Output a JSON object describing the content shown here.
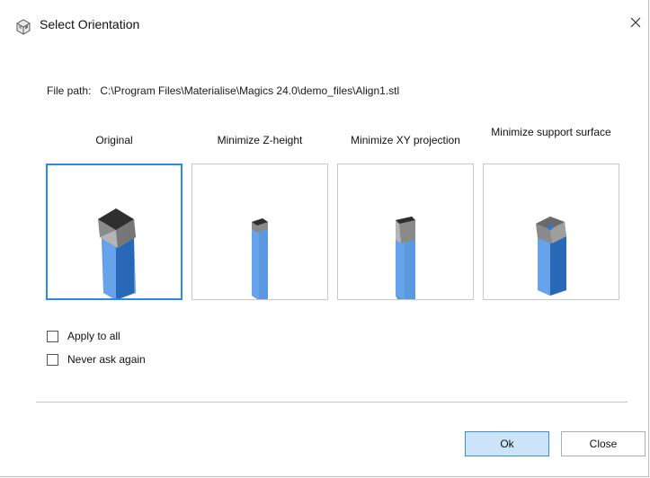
{
  "window": {
    "title": "Select Orientation",
    "icon": "cube-icon",
    "close_icon": "close-icon"
  },
  "file_path": {
    "label": "File path:",
    "value": "C:\\Program Files\\Materialise\\Magics 24.0\\demo_files\\Align1.stl"
  },
  "options": [
    {
      "label": "Original",
      "selected": true
    },
    {
      "label": "Minimize Z-height",
      "selected": false
    },
    {
      "label": "Minimize XY projection",
      "selected": false
    },
    {
      "label": "Minimize support surface",
      "selected": false
    }
  ],
  "checkboxes": [
    {
      "label": "Apply to all",
      "checked": false
    },
    {
      "label": "Never ask again",
      "checked": false
    }
  ],
  "buttons": {
    "ok": "Ok",
    "close": "Close"
  },
  "colors": {
    "selected_border": "#2a8be6",
    "ok_fill": "#cce4f7",
    "model_blue": "#2f7fd8",
    "model_dark": "#333333"
  }
}
